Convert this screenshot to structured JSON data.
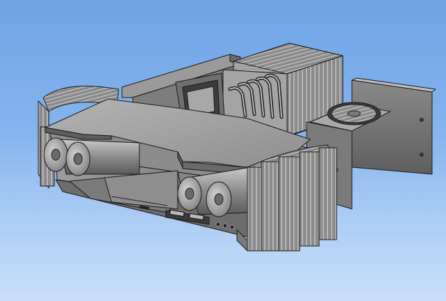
{
  "viewport": {
    "background_top": "#6fa3e6",
    "background_bottom": "#c9dff8"
  },
  "model": {
    "shading": "shaded-with-edges",
    "base_color": "#9a9a9a",
    "highlight_color": "#c8c8c8",
    "shadow_color": "#5c5c5c",
    "edge_color": "#1a1a1a"
  }
}
